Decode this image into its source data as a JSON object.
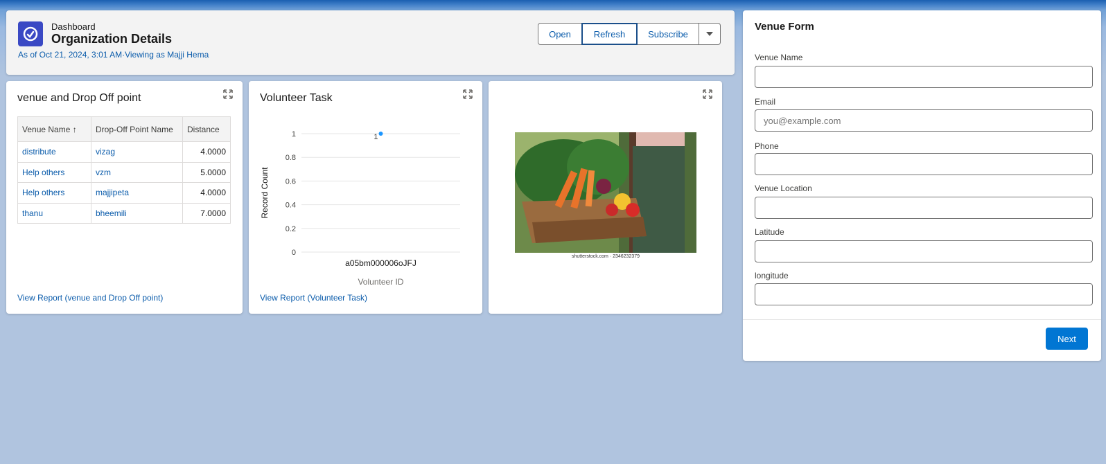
{
  "header": {
    "label": "Dashboard",
    "title": "Organization Details",
    "subtitle": "As of Oct 21, 2024, 3:01 AM·Viewing as Majji Hema",
    "buttons": {
      "open": "Open",
      "refresh": "Refresh",
      "subscribe": "Subscribe"
    }
  },
  "widget1": {
    "title": "venue and Drop Off point",
    "columns": [
      "Venue Name",
      "Drop-Off Point Name",
      "Distance"
    ],
    "sort_indicator": "↑",
    "rows": [
      [
        "distribute",
        "vizag",
        "4.0000"
      ],
      [
        "Help others",
        "vzm",
        "5.0000"
      ],
      [
        "Help others",
        "majjipeta",
        "4.0000"
      ],
      [
        "thanu",
        "bheemili",
        "7.0000"
      ]
    ],
    "link": "View Report (venue and Drop Off point)"
  },
  "widget2": {
    "title": "Volunteer Task",
    "link": "View Report (Volunteer Task)"
  },
  "widget3": {
    "caption": "shutterstock.com · 2346232379"
  },
  "chart_data": {
    "type": "scatter",
    "categories": [
      "a05bm000006oJFJ"
    ],
    "values": [
      1
    ],
    "data_labels": [
      "1"
    ],
    "xlabel": "Volunteer ID",
    "ylabel": "Record Count",
    "ylim": [
      0,
      1
    ],
    "yticks": [
      "0",
      "0.2",
      "0.4",
      "0.6",
      "0.8",
      "1"
    ],
    "grid": true,
    "color": "#1b96ff"
  },
  "form": {
    "title": "Venue Form",
    "fields": [
      {
        "label": "Venue Name",
        "value": "",
        "placeholder": ""
      },
      {
        "label": "Email",
        "value": "",
        "placeholder": "you@example.com"
      },
      {
        "label": "Phone",
        "value": "",
        "placeholder": ""
      },
      {
        "label": "Venue Location",
        "value": "",
        "placeholder": ""
      },
      {
        "label": "Latitude",
        "value": "",
        "placeholder": ""
      },
      {
        "label": "longitude",
        "value": "",
        "placeholder": ""
      }
    ],
    "next": "Next"
  },
  "colors": {
    "brand": "#0176d3",
    "link": "#0b5cab",
    "dashboard_icon": "#3a49c4",
    "background": "#b0c4df"
  },
  "icons": [
    "dashboard-icon",
    "expand-icon",
    "chevron-down-icon",
    "sort-up-icon"
  ]
}
